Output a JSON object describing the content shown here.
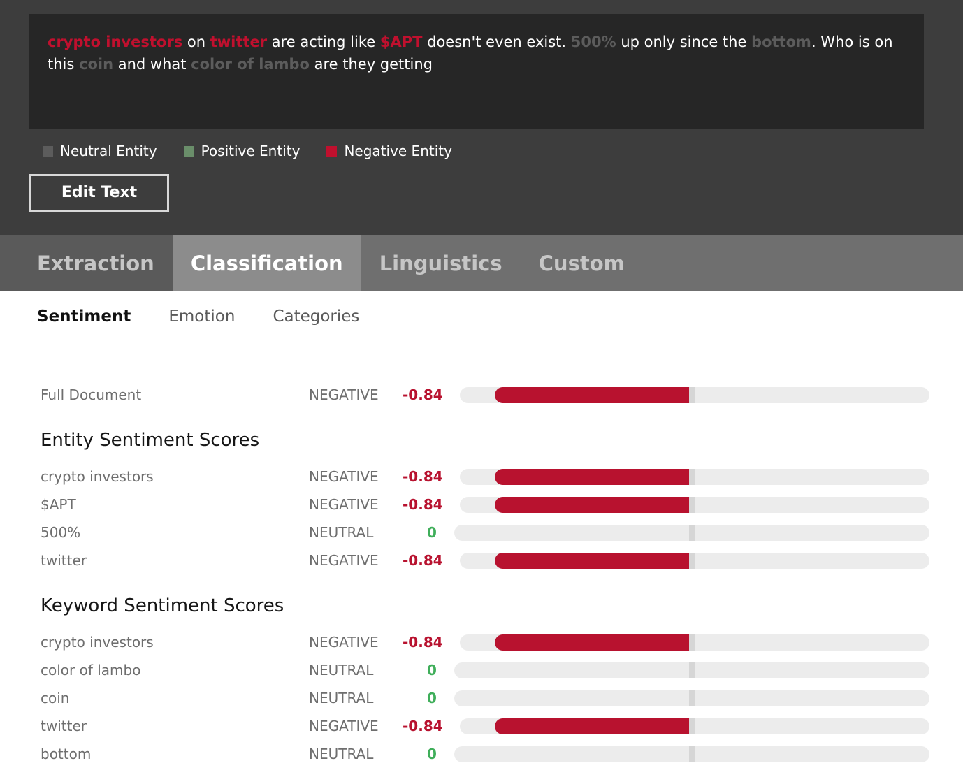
{
  "input_text": {
    "segments": [
      {
        "text": "crypto investors",
        "entity": "negative"
      },
      {
        "text": " on ",
        "entity": null
      },
      {
        "text": "twitter",
        "entity": "negative"
      },
      {
        "text": " are acting like ",
        "entity": null
      },
      {
        "text": "$APT",
        "entity": "negative"
      },
      {
        "text": " doesn't even exist. ",
        "entity": null
      },
      {
        "text": "500%",
        "entity": "neutral"
      },
      {
        "text": " up only since the ",
        "entity": null
      },
      {
        "text": "bottom",
        "entity": "neutral"
      },
      {
        "text": ". Who is on this ",
        "entity": null
      },
      {
        "text": "coin",
        "entity": "neutral"
      },
      {
        "text": " and what ",
        "entity": null
      },
      {
        "text": "color of lambo",
        "entity": "neutral"
      },
      {
        "text": " are they getting",
        "entity": null
      }
    ]
  },
  "legend": [
    {
      "label": "Neutral Entity",
      "color": "#5c5c5c"
    },
    {
      "label": "Positive Entity",
      "color": "#6a8e6a"
    },
    {
      "label": "Negative Entity",
      "color": "#c0102e"
    }
  ],
  "edit_button": {
    "label": "Edit Text"
  },
  "tabs": [
    {
      "label": "Extraction",
      "active": false
    },
    {
      "label": "Classification",
      "active": true
    },
    {
      "label": "Linguistics",
      "active": false
    },
    {
      "label": "Custom",
      "active": false
    }
  ],
  "subtabs": [
    {
      "label": "Sentiment",
      "active": true
    },
    {
      "label": "Emotion",
      "active": false
    },
    {
      "label": "Categories",
      "active": false
    }
  ],
  "colors": {
    "negative": "#b8122f",
    "neutral": "#3fae5a"
  },
  "full_document": {
    "label": "Full Document",
    "class": "NEGATIVE",
    "score": "-0.84",
    "value": -0.84
  },
  "entity_section": {
    "title": "Entity Sentiment Scores",
    "rows": [
      {
        "label": "crypto investors",
        "class": "NEGATIVE",
        "score": "-0.84",
        "value": -0.84
      },
      {
        "label": "$APT",
        "class": "NEGATIVE",
        "score": "-0.84",
        "value": -0.84
      },
      {
        "label": "500%",
        "class": "NEUTRAL",
        "score": "0",
        "value": 0
      },
      {
        "label": "twitter",
        "class": "NEGATIVE",
        "score": "-0.84",
        "value": -0.84
      }
    ]
  },
  "keyword_section": {
    "title": "Keyword Sentiment Scores",
    "rows": [
      {
        "label": "crypto investors",
        "class": "NEGATIVE",
        "score": "-0.84",
        "value": -0.84
      },
      {
        "label": "color of lambo",
        "class": "NEUTRAL",
        "score": "0",
        "value": 0
      },
      {
        "label": "coin",
        "class": "NEUTRAL",
        "score": "0",
        "value": 0
      },
      {
        "label": "twitter",
        "class": "NEGATIVE",
        "score": "-0.84",
        "value": -0.84
      },
      {
        "label": "bottom",
        "class": "NEUTRAL",
        "score": "0",
        "value": 0
      }
    ]
  }
}
